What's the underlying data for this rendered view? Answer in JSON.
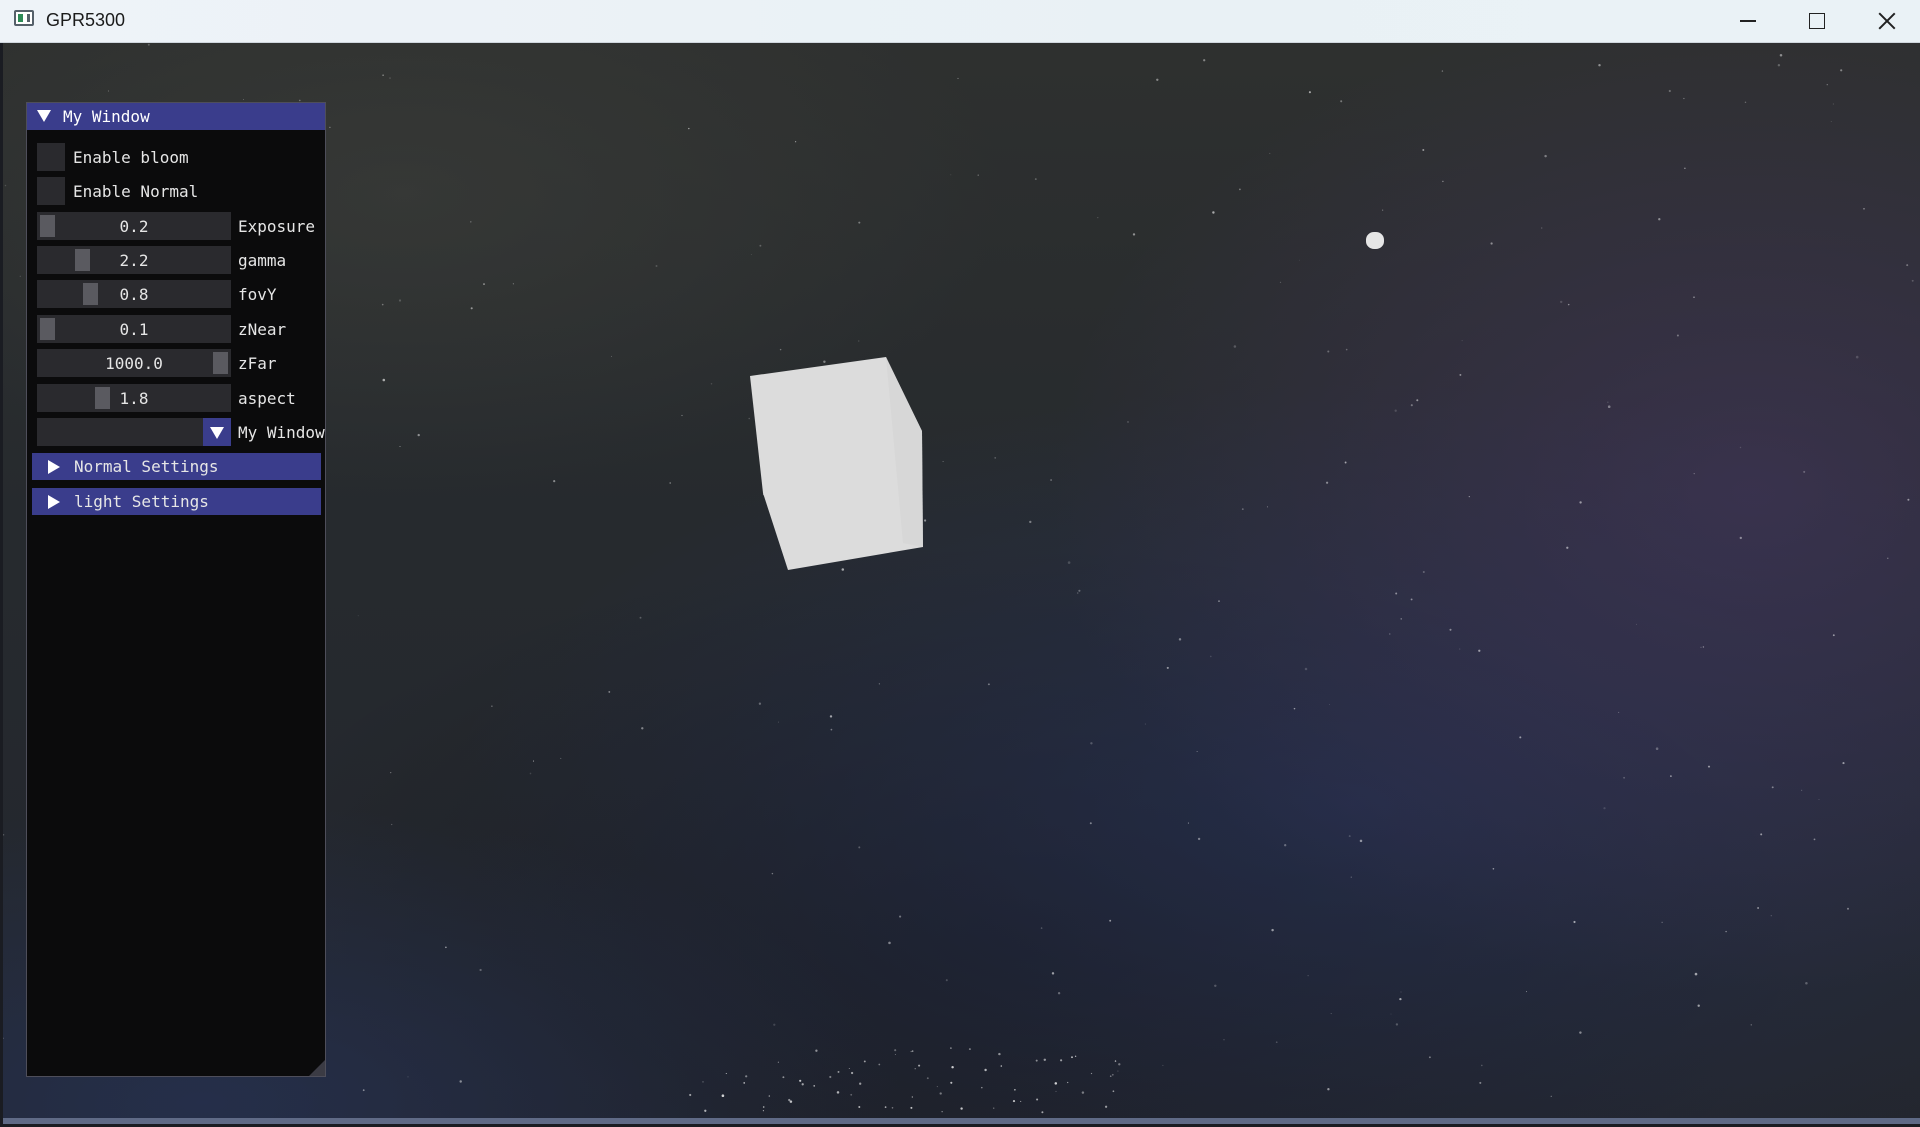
{
  "window": {
    "title": "GPR5300"
  },
  "panel": {
    "title": "My Window",
    "checkboxes": [
      {
        "label": "Enable bloom",
        "checked": false
      },
      {
        "label": "Enable Normal",
        "checked": false
      }
    ],
    "sliders": [
      {
        "label": "Exposure",
        "value": "0.2",
        "fraction": 0.0
      },
      {
        "label": "gamma",
        "value": "2.2",
        "fraction": 0.2
      },
      {
        "label": "fovY",
        "value": "0.8",
        "fraction": 0.25
      },
      {
        "label": "zNear",
        "value": "0.1",
        "fraction": 0.0
      },
      {
        "label": "zFar",
        "value": "1000.0",
        "fraction": 1.0
      },
      {
        "label": "aspect",
        "value": "1.8",
        "fraction": 0.32
      }
    ],
    "combo": {
      "label": "My Window",
      "value": ""
    },
    "tree_nodes": [
      {
        "label": "Normal Settings",
        "expanded": false
      },
      {
        "label": "light Settings",
        "expanded": false
      }
    ]
  },
  "colors": {
    "header": "#3a3d8c",
    "panel_bg": "#0b0b0c",
    "widget_bg": "#2a2a2e",
    "cube": "#dcdcdc"
  }
}
